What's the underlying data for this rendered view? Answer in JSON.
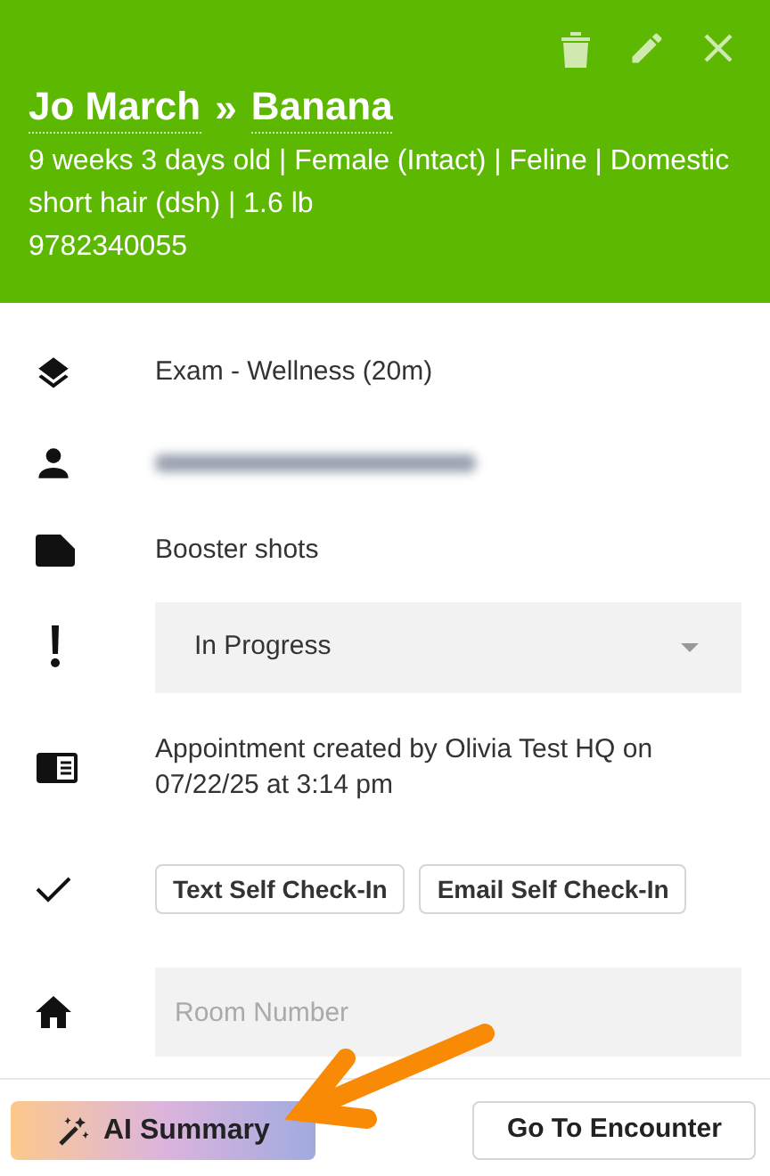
{
  "header": {
    "owner": "Jo March",
    "separator": "»",
    "patient": "Banana",
    "details": "9 weeks 3 days old | Female (Intact) | Feline | Domestic short hair (dsh) | 1.6 lb",
    "phone": "9782340055"
  },
  "rows": [
    {
      "kind": "text",
      "text": "Exam - Wellness (20m)"
    },
    {
      "kind": "blurred"
    },
    {
      "kind": "text",
      "text": "Booster shots"
    },
    {
      "kind": "select",
      "value": "In Progress"
    },
    {
      "kind": "text",
      "text": "Appointment created by Olivia Test HQ on 07/22/25 at 3:14 pm"
    },
    {
      "kind": "buttons",
      "buttons": [
        "Text Self Check-In",
        "Email Self Check-In"
      ]
    },
    {
      "kind": "input",
      "placeholder": "Room Number"
    }
  ],
  "footer": {
    "ai_button": "AI Summary",
    "encounter_button": "Go To Encounter"
  }
}
